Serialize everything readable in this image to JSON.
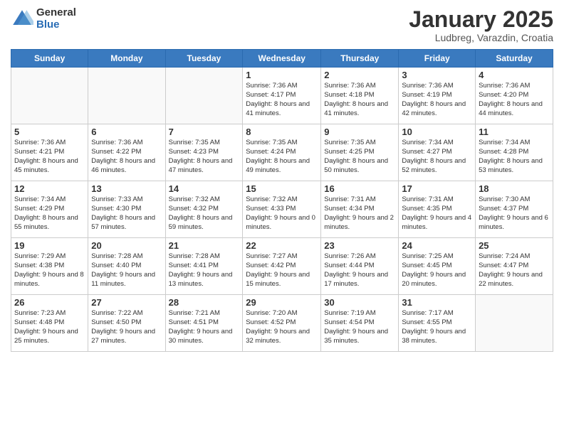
{
  "logo": {
    "general": "General",
    "blue": "Blue"
  },
  "title": "January 2025",
  "subtitle": "Ludbreg, Varazdin, Croatia",
  "days_of_week": [
    "Sunday",
    "Monday",
    "Tuesday",
    "Wednesday",
    "Thursday",
    "Friday",
    "Saturday"
  ],
  "weeks": [
    [
      {
        "day": "",
        "info": ""
      },
      {
        "day": "",
        "info": ""
      },
      {
        "day": "",
        "info": ""
      },
      {
        "day": "1",
        "info": "Sunrise: 7:36 AM\nSunset: 4:17 PM\nDaylight: 8 hours and 41 minutes."
      },
      {
        "day": "2",
        "info": "Sunrise: 7:36 AM\nSunset: 4:18 PM\nDaylight: 8 hours and 41 minutes."
      },
      {
        "day": "3",
        "info": "Sunrise: 7:36 AM\nSunset: 4:19 PM\nDaylight: 8 hours and 42 minutes."
      },
      {
        "day": "4",
        "info": "Sunrise: 7:36 AM\nSunset: 4:20 PM\nDaylight: 8 hours and 44 minutes."
      }
    ],
    [
      {
        "day": "5",
        "info": "Sunrise: 7:36 AM\nSunset: 4:21 PM\nDaylight: 8 hours and 45 minutes."
      },
      {
        "day": "6",
        "info": "Sunrise: 7:36 AM\nSunset: 4:22 PM\nDaylight: 8 hours and 46 minutes."
      },
      {
        "day": "7",
        "info": "Sunrise: 7:35 AM\nSunset: 4:23 PM\nDaylight: 8 hours and 47 minutes."
      },
      {
        "day": "8",
        "info": "Sunrise: 7:35 AM\nSunset: 4:24 PM\nDaylight: 8 hours and 49 minutes."
      },
      {
        "day": "9",
        "info": "Sunrise: 7:35 AM\nSunset: 4:25 PM\nDaylight: 8 hours and 50 minutes."
      },
      {
        "day": "10",
        "info": "Sunrise: 7:34 AM\nSunset: 4:27 PM\nDaylight: 8 hours and 52 minutes."
      },
      {
        "day": "11",
        "info": "Sunrise: 7:34 AM\nSunset: 4:28 PM\nDaylight: 8 hours and 53 minutes."
      }
    ],
    [
      {
        "day": "12",
        "info": "Sunrise: 7:34 AM\nSunset: 4:29 PM\nDaylight: 8 hours and 55 minutes."
      },
      {
        "day": "13",
        "info": "Sunrise: 7:33 AM\nSunset: 4:30 PM\nDaylight: 8 hours and 57 minutes."
      },
      {
        "day": "14",
        "info": "Sunrise: 7:32 AM\nSunset: 4:32 PM\nDaylight: 8 hours and 59 minutes."
      },
      {
        "day": "15",
        "info": "Sunrise: 7:32 AM\nSunset: 4:33 PM\nDaylight: 9 hours and 0 minutes."
      },
      {
        "day": "16",
        "info": "Sunrise: 7:31 AM\nSunset: 4:34 PM\nDaylight: 9 hours and 2 minutes."
      },
      {
        "day": "17",
        "info": "Sunrise: 7:31 AM\nSunset: 4:35 PM\nDaylight: 9 hours and 4 minutes."
      },
      {
        "day": "18",
        "info": "Sunrise: 7:30 AM\nSunset: 4:37 PM\nDaylight: 9 hours and 6 minutes."
      }
    ],
    [
      {
        "day": "19",
        "info": "Sunrise: 7:29 AM\nSunset: 4:38 PM\nDaylight: 9 hours and 8 minutes."
      },
      {
        "day": "20",
        "info": "Sunrise: 7:28 AM\nSunset: 4:40 PM\nDaylight: 9 hours and 11 minutes."
      },
      {
        "day": "21",
        "info": "Sunrise: 7:28 AM\nSunset: 4:41 PM\nDaylight: 9 hours and 13 minutes."
      },
      {
        "day": "22",
        "info": "Sunrise: 7:27 AM\nSunset: 4:42 PM\nDaylight: 9 hours and 15 minutes."
      },
      {
        "day": "23",
        "info": "Sunrise: 7:26 AM\nSunset: 4:44 PM\nDaylight: 9 hours and 17 minutes."
      },
      {
        "day": "24",
        "info": "Sunrise: 7:25 AM\nSunset: 4:45 PM\nDaylight: 9 hours and 20 minutes."
      },
      {
        "day": "25",
        "info": "Sunrise: 7:24 AM\nSunset: 4:47 PM\nDaylight: 9 hours and 22 minutes."
      }
    ],
    [
      {
        "day": "26",
        "info": "Sunrise: 7:23 AM\nSunset: 4:48 PM\nDaylight: 9 hours and 25 minutes."
      },
      {
        "day": "27",
        "info": "Sunrise: 7:22 AM\nSunset: 4:50 PM\nDaylight: 9 hours and 27 minutes."
      },
      {
        "day": "28",
        "info": "Sunrise: 7:21 AM\nSunset: 4:51 PM\nDaylight: 9 hours and 30 minutes."
      },
      {
        "day": "29",
        "info": "Sunrise: 7:20 AM\nSunset: 4:52 PM\nDaylight: 9 hours and 32 minutes."
      },
      {
        "day": "30",
        "info": "Sunrise: 7:19 AM\nSunset: 4:54 PM\nDaylight: 9 hours and 35 minutes."
      },
      {
        "day": "31",
        "info": "Sunrise: 7:17 AM\nSunset: 4:55 PM\nDaylight: 9 hours and 38 minutes."
      },
      {
        "day": "",
        "info": ""
      }
    ]
  ]
}
